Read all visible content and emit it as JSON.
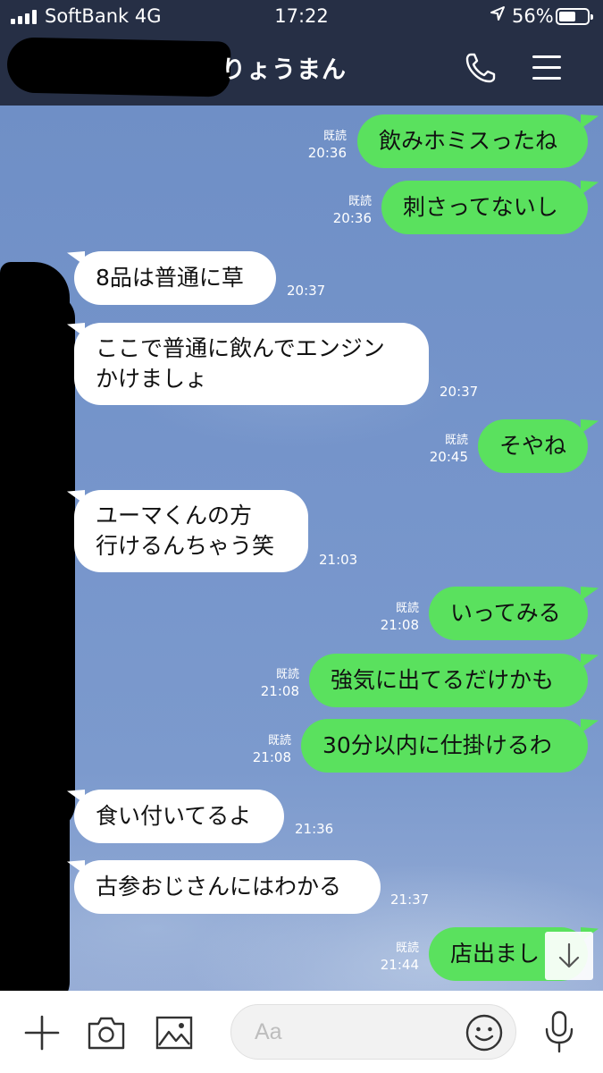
{
  "status_bar": {
    "carrier": "SoftBank 4G",
    "time": "17:22",
    "battery_percent": "56%",
    "battery_level": 0.56,
    "location_icon": "location-arrow-icon"
  },
  "header": {
    "chat_name": "りょうまん",
    "phone_icon": "phone-icon",
    "menu_icon": "hamburger-menu-icon"
  },
  "messages": [
    {
      "side": "me",
      "text": "飲みホミスったね",
      "time": "20:36",
      "read": "既読"
    },
    {
      "side": "me",
      "text": "刺さってないし",
      "time": "20:36",
      "read": "既読"
    },
    {
      "side": "them",
      "text": "8品は普通に草",
      "time": "20:37"
    },
    {
      "side": "them",
      "line1": "ここで普通に飲んでエンジン",
      "line2": "かけましょ",
      "time": "20:37"
    },
    {
      "side": "me",
      "text": "そやね",
      "time": "20:45",
      "read": "既読"
    },
    {
      "side": "them",
      "line1": "ユーマくんの方",
      "line2": "行けるんちゃう笑",
      "time": "21:03"
    },
    {
      "side": "me",
      "text": "いってみる",
      "time": "21:08",
      "read": "既読"
    },
    {
      "side": "me",
      "text": "強気に出てるだけかも",
      "time": "21:08",
      "read": "既読"
    },
    {
      "side": "me",
      "text": "30分以内に仕掛けるわ",
      "time": "21:08",
      "read": "既読"
    },
    {
      "side": "them",
      "text": "食い付いてるよ",
      "time": "21:36"
    },
    {
      "side": "them",
      "text": "古参おじさんにはわかる",
      "time": "21:37"
    },
    {
      "side": "me",
      "text": "店出まし",
      "time": "21:44",
      "read": "既読"
    }
  ],
  "composer": {
    "placeholder": "Aa",
    "icons": [
      "plus-icon",
      "camera-icon",
      "image-icon",
      "emoji-icon",
      "microphone-icon"
    ]
  },
  "colors": {
    "header_bg": "#262f45",
    "bubble_me": "#5ae15e",
    "bubble_them": "#ffffff",
    "chat_bg": "#7695cb"
  }
}
